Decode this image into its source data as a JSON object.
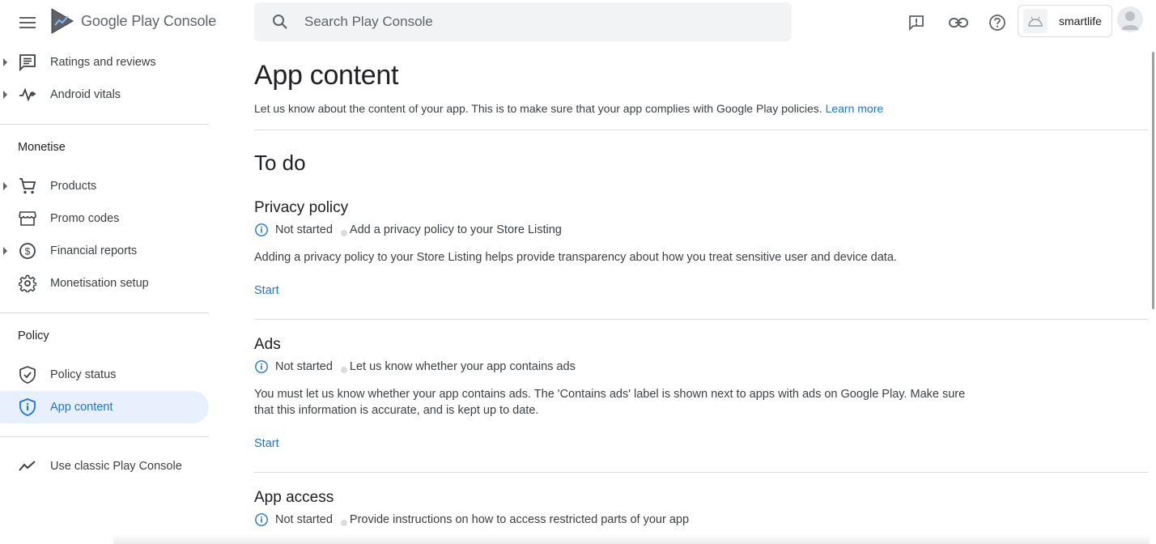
{
  "app": {
    "logo_text": "Google Play",
    "logo_suffix": "Console"
  },
  "search": {
    "placeholder": "Search Play Console"
  },
  "account": {
    "name": "smartlife"
  },
  "sidebar": {
    "items_top": [
      {
        "label": "Ratings and reviews",
        "icon": "reviews-icon"
      },
      {
        "label": "Android vitals",
        "icon": "vitals-icon"
      }
    ],
    "monetise": {
      "title": "Monetise",
      "items": [
        {
          "label": "Products",
          "icon": "cart-icon"
        },
        {
          "label": "Promo codes",
          "icon": "store-icon"
        },
        {
          "label": "Financial reports",
          "icon": "dollar-icon"
        },
        {
          "label": "Monetisation setup",
          "icon": "gear-icon"
        }
      ]
    },
    "policy": {
      "title": "Policy",
      "items": [
        {
          "label": "Policy status",
          "icon": "shield-check-icon"
        },
        {
          "label": "App content",
          "icon": "shield-info-icon"
        }
      ]
    },
    "classic": {
      "label": "Use classic Play Console",
      "icon": "trend-icon"
    }
  },
  "main": {
    "title": "App content",
    "description": "Let us know about the content of your app. This is to make sure that your app complies with Google Play policies.",
    "learn_more": "Learn more",
    "todo_title": "To do",
    "cards": [
      {
        "title": "Privacy policy",
        "status": "Not started",
        "summary": "Add a privacy policy to your Store Listing",
        "description": "Adding a privacy policy to your Store Listing helps provide transparency about how you treat sensitive user and device data.",
        "action": "Start"
      },
      {
        "title": "Ads",
        "status": "Not started",
        "summary": "Let us know whether your app contains ads",
        "description": "You must let us know whether your app contains ads. The 'Contains ads' label is shown next to apps with ads on Google Play. Make sure that this information is accurate, and is kept up to date.",
        "action": "Start"
      },
      {
        "title": "App access",
        "status": "Not started",
        "summary": "Provide instructions on how to access restricted parts of your app"
      }
    ]
  },
  "colors": {
    "accent": "#1a73e8",
    "active_bg": "#e8f0fe",
    "divider": "#dadce0"
  }
}
